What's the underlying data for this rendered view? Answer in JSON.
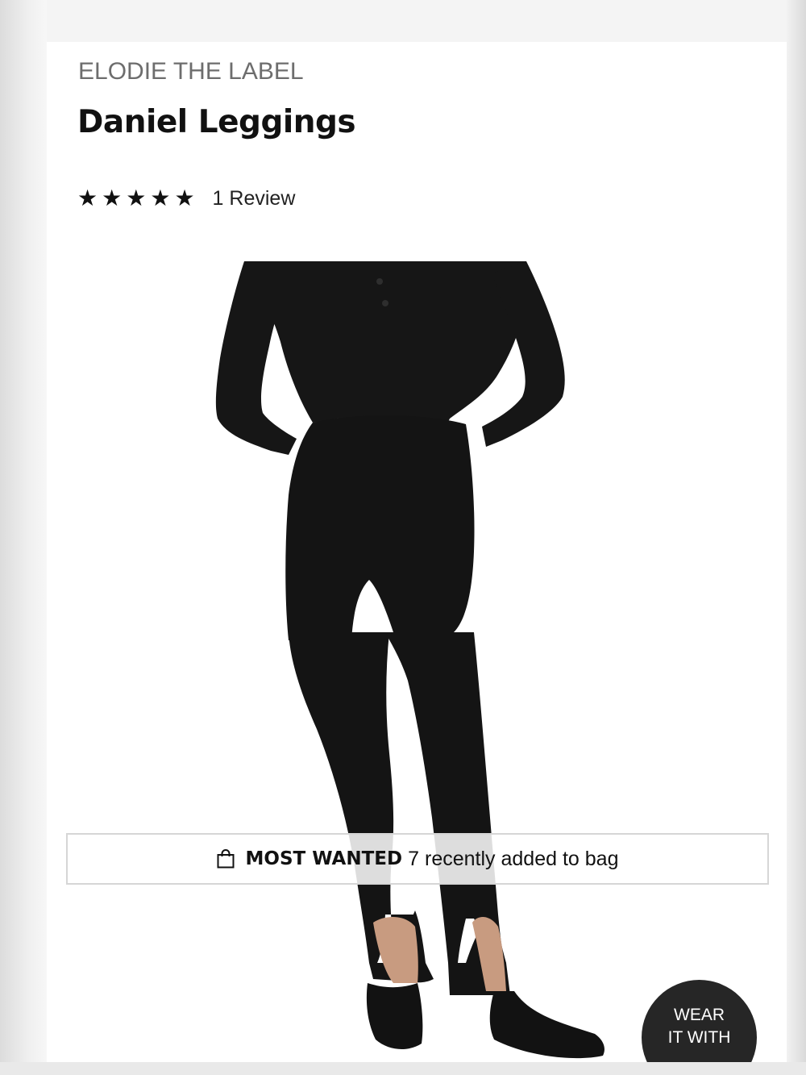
{
  "product": {
    "brand": "ELODIE THE LABEL",
    "title": "Daniel Leggings",
    "rating": {
      "stars": 5,
      "review_text": "1 Review",
      "star_glyph": "★"
    }
  },
  "image": {
    "icon": "product-photo-woman-black-stirrup-leggings"
  },
  "banner": {
    "icon": "shopping-bag-icon",
    "label": "MOST WANTED",
    "count": "7",
    "text": "recently added to bag"
  },
  "wear_with": {
    "line1": "WEAR",
    "line2": "IT WITH"
  },
  "colors": {
    "brand_text": "#6d6d6d",
    "title_text": "#111111",
    "garment": "#141414",
    "wear_with_bg": "#262626"
  }
}
